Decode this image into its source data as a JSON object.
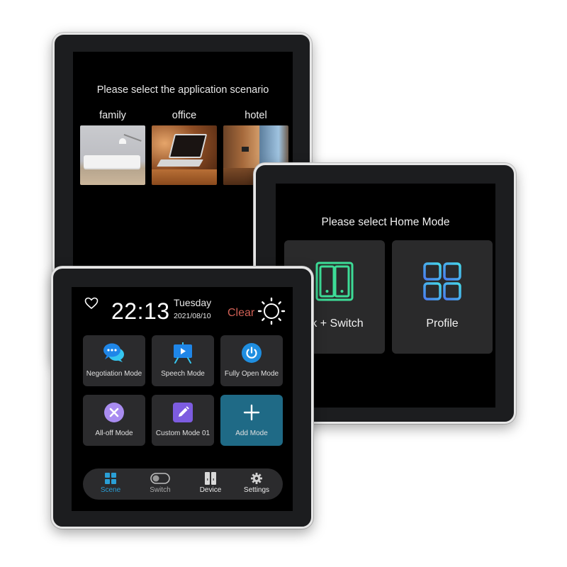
{
  "scenario_panel": {
    "title": "Please select the application scenario",
    "options": [
      {
        "label": "family",
        "image": "living-room-photo"
      },
      {
        "label": "office",
        "image": "laptop-desk-photo"
      },
      {
        "label": "hotel",
        "image": "hotel-room-photo"
      }
    ]
  },
  "home_mode_panel": {
    "title": "Please select Home Mode",
    "options": [
      {
        "label": "ck + Switch",
        "icon": "double-switch-icon",
        "color": "#3ddc97"
      },
      {
        "label": "Profile",
        "icon": "grid-icon",
        "color": "#4a9cf0"
      }
    ]
  },
  "main_panel": {
    "header": {
      "favorite_icon": "heart-icon",
      "time": "22:13",
      "weekday": "Tuesday",
      "date": "2021/08/10",
      "weather": "Clear",
      "weather_icon": "sun-icon",
      "weather_color": "#d06055"
    },
    "modes": [
      {
        "label": "Negotiation Mode",
        "icon": "chat-bubbles-icon"
      },
      {
        "label": "Speech Mode",
        "icon": "presentation-icon"
      },
      {
        "label": "Fully Open Mode",
        "icon": "power-icon"
      },
      {
        "label": "All-off Mode",
        "icon": "close-circle-icon"
      },
      {
        "label": "Custom Mode 01",
        "icon": "edit-icon"
      },
      {
        "label": "Add Mode",
        "icon": "plus-icon",
        "accent": "#1f6a86"
      }
    ],
    "nav": [
      {
        "label": "Scene",
        "icon": "scene-grid-icon",
        "active": true
      },
      {
        "label": "Switch",
        "icon": "toggle-icon",
        "active": false
      },
      {
        "label": "Device",
        "icon": "device-icon",
        "active": false
      },
      {
        "label": "Settings",
        "icon": "gear-icon",
        "active": false
      }
    ],
    "active_color": "#2a9fd6"
  }
}
